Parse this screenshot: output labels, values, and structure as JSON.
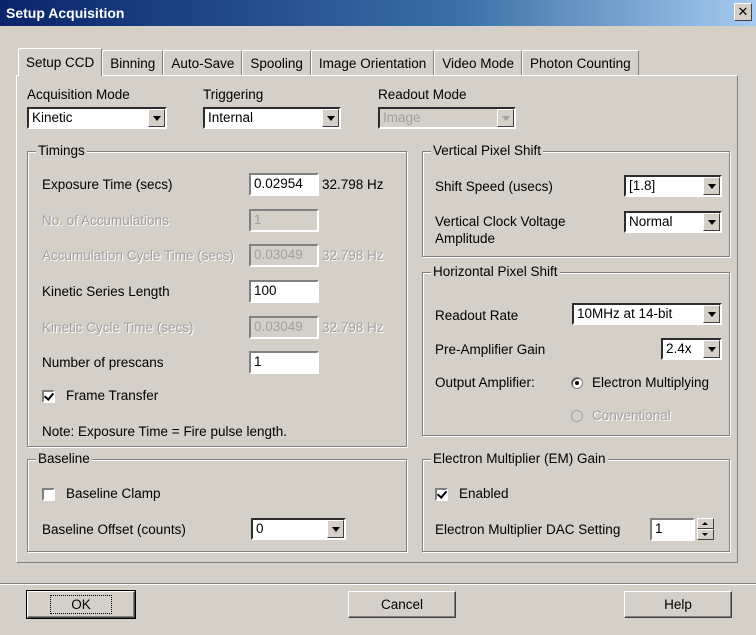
{
  "window": {
    "title": "Setup Acquisition",
    "close_glyph": "✕"
  },
  "tabs": [
    {
      "label": "Setup CCD",
      "active": true
    },
    {
      "label": "Binning"
    },
    {
      "label": "Auto-Save"
    },
    {
      "label": "Spooling"
    },
    {
      "label": "Image Orientation"
    },
    {
      "label": "Video Mode"
    },
    {
      "label": "Photon Counting"
    }
  ],
  "acquisition_mode": {
    "label": "Acquisition Mode",
    "value": "Kinetic"
  },
  "triggering": {
    "label": "Triggering",
    "value": "Internal"
  },
  "readout_mode": {
    "label": "Readout Mode",
    "value": "Image"
  },
  "timings": {
    "title": "Timings",
    "exposure_time": {
      "label": "Exposure Time (secs)",
      "value": "0.02954",
      "hz": "32.798 Hz"
    },
    "accumulations": {
      "label": "No. of Accumulations",
      "value": "1"
    },
    "accumulation_cycle": {
      "label": "Accumulation Cycle Time (secs)",
      "value": "0.03049",
      "hz": "32.798 Hz"
    },
    "kinetic_length": {
      "label": "Kinetic Series Length",
      "value": "100"
    },
    "kinetic_cycle": {
      "label": "Kinetic Cycle Time (secs)",
      "value": "0.03049",
      "hz": "32.798 Hz"
    },
    "prescans": {
      "label": "Number of prescans",
      "value": "1"
    },
    "frame_transfer": {
      "label": "Frame Transfer",
      "checked": true
    },
    "note": "Note: Exposure Time = Fire pulse length."
  },
  "baseline": {
    "title": "Baseline",
    "clamp": {
      "label": "Baseline Clamp",
      "checked": false
    },
    "offset": {
      "label": "Baseline Offset (counts)",
      "value": "0"
    }
  },
  "vertical": {
    "title": "Vertical Pixel Shift",
    "shift_speed": {
      "label": "Shift Speed (usecs)",
      "value": "[1.8]"
    },
    "clock_voltage": {
      "label_line1": "Vertical Clock Voltage",
      "label_line2": "Amplitude",
      "value": "Normal"
    }
  },
  "horizontal": {
    "title": "Horizontal Pixel Shift",
    "readout_rate": {
      "label": "Readout Rate",
      "value": "10MHz at 14-bit"
    },
    "preamp": {
      "label": "Pre-Amplifier Gain",
      "value": "2.4x"
    },
    "output_amp": {
      "label": "Output Amplifier:",
      "em": "Electron Multiplying",
      "conventional": "Conventional"
    }
  },
  "em_gain": {
    "title": "Electron Multiplier (EM) Gain",
    "enabled": {
      "label": "Enabled",
      "checked": true
    },
    "dac": {
      "label": "Electron Multiplier DAC Setting",
      "value": "1"
    }
  },
  "buttons": {
    "ok": "OK",
    "cancel": "Cancel",
    "help": "Help"
  }
}
